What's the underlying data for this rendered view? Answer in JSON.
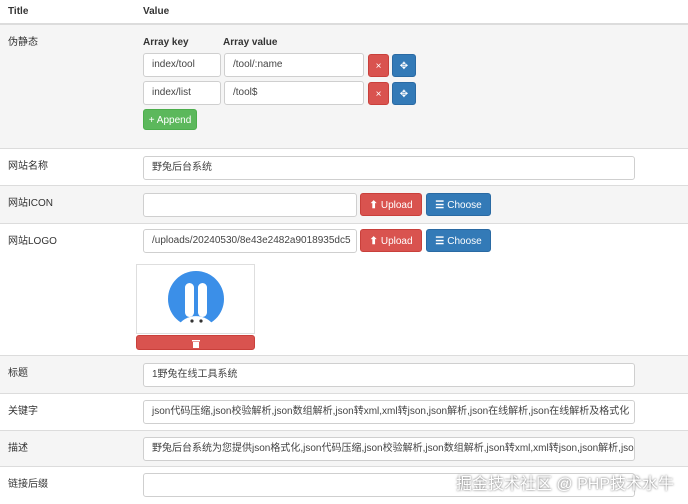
{
  "header": {
    "title_col": "Title",
    "value_col": "Value"
  },
  "pseudo": {
    "label": "伪静态",
    "key_header": "Array key",
    "value_header": "Array value",
    "rows": [
      {
        "key": "index/tool",
        "value": "/tool/:name"
      },
      {
        "key": "index/list",
        "value": "/tool$"
      }
    ],
    "remove_icon": "×",
    "move_icon": "✥",
    "append_label": "+ Append"
  },
  "site_name": {
    "label": "网站名称",
    "value": "野兔后台系统"
  },
  "site_icon": {
    "label": "网站ICON",
    "value": "",
    "upload": "Upload",
    "choose": "Choose"
  },
  "site_logo": {
    "label": "网站LOGO",
    "value": "/uploads/20240530/8e43e2482a9018935dc5",
    "upload": "Upload",
    "choose": "Choose",
    "delete_icon": "trash-icon"
  },
  "title": {
    "label": "标题",
    "value": "1野兔在线工具系统"
  },
  "keywords": {
    "label": "关键字",
    "value": "json代码压缩,json校验解析,json数组解析,json转xml,xml转json,json解析,json在线解析,json在线解析及格式化"
  },
  "description": {
    "label": "描述",
    "value": "野兔后台系统为您提供json格式化,json代码压缩,json校验解析,json数组解析,json转xml,xml转json,json解析,json"
  },
  "link_suffix": {
    "label": "链接后缀",
    "value": ""
  },
  "watermark": "掘金技术社区 @ PHP技术水牛",
  "colors": {
    "danger": "#d9534f",
    "primary": "#337ab7",
    "success": "#5cb85c",
    "logo_blue": "#3b8fe8"
  }
}
